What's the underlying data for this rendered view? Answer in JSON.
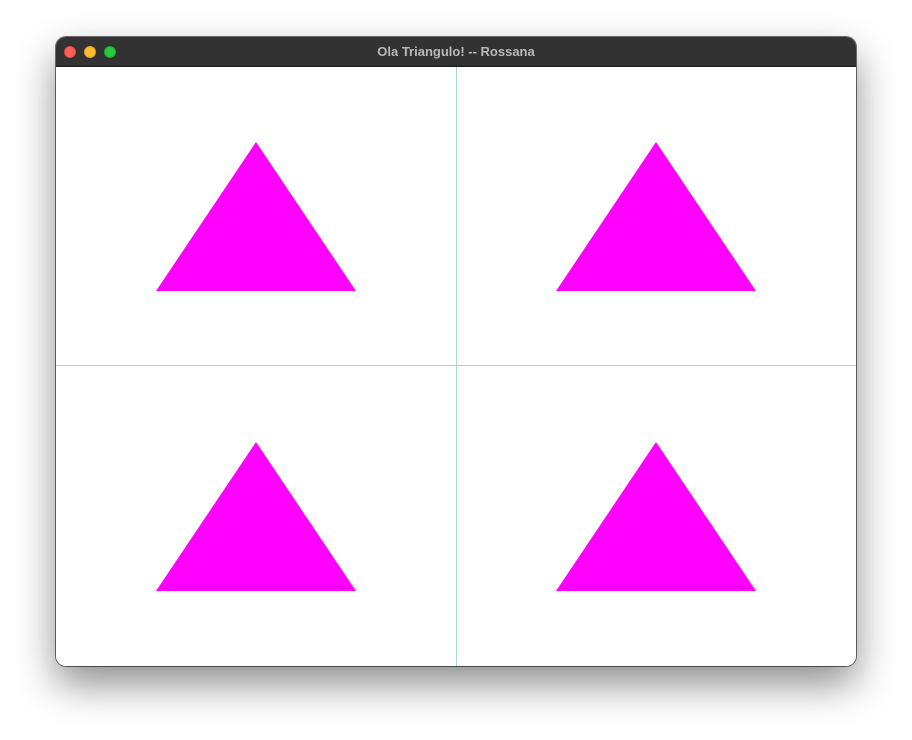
{
  "window": {
    "title": "Ola Triangulo! -- Rossana"
  },
  "viewport": {
    "grid": "2x2",
    "background_color": "#ffffff",
    "divider_color": "#a8d4e6",
    "triangle_color": "#ff00ff",
    "triangle_count": 4
  }
}
